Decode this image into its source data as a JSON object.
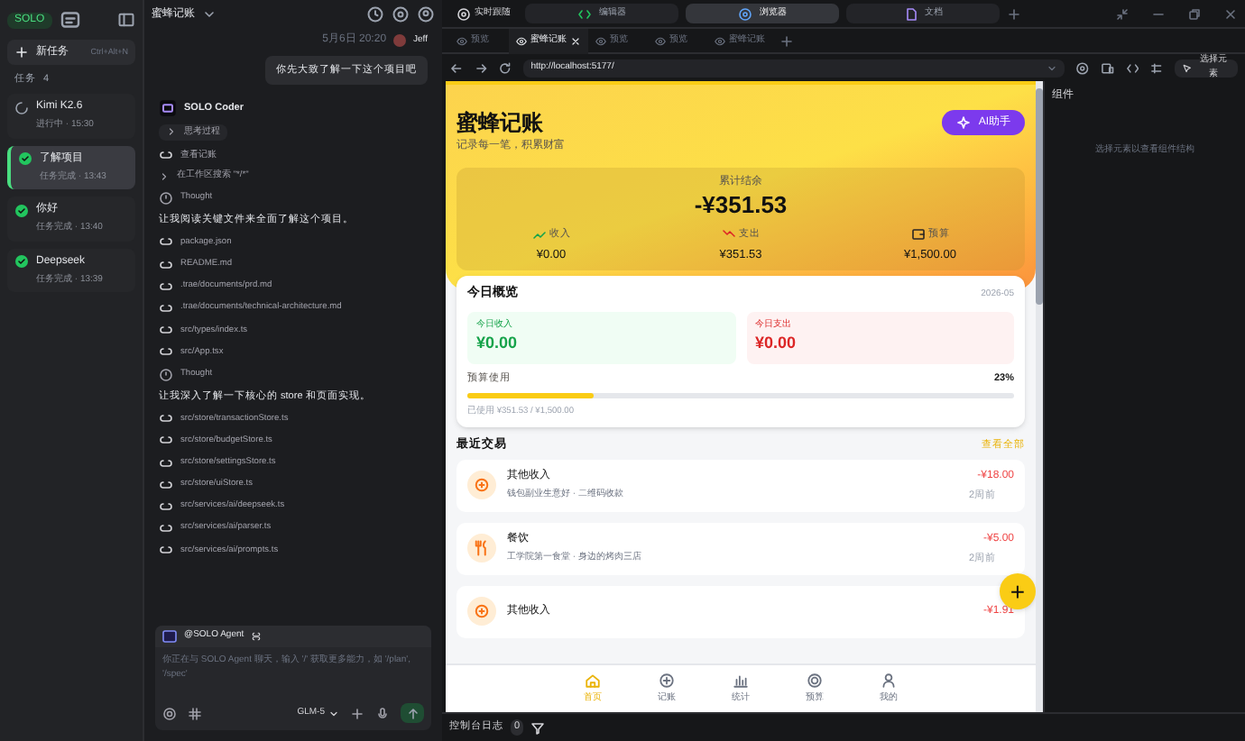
{
  "sidebar": {
    "logo": "SOLO",
    "new_task": {
      "label": "新任务",
      "shortcut": "Ctrl+Alt+N"
    },
    "tasks_label": "任务",
    "tasks_count": "4",
    "tasks": [
      {
        "title": "Kimi K2.6",
        "status": "进行中 · 15:30",
        "kind": "running",
        "selected": false
      },
      {
        "title": "了解项目",
        "status": "任务完成 · 13:43",
        "kind": "done",
        "selected": true
      },
      {
        "title": "你好",
        "status": "任务完成 · 13:40",
        "kind": "done",
        "selected": false
      },
      {
        "title": "Deepseek",
        "status": "任务完成 · 13:39",
        "kind": "done",
        "selected": false
      }
    ]
  },
  "chat": {
    "project": "蜜蜂记账",
    "time": "5月6日 20:20",
    "user": "Jeff",
    "message": "你先大致了解一下这个项目吧",
    "agent": "SOLO Coder",
    "steps": [
      {
        "kind": "toggle",
        "text": "思考过程"
      },
      {
        "kind": "file",
        "text": "查看记账"
      },
      {
        "kind": "arrow",
        "text": "在工作区搜索 \"*/*\""
      },
      {
        "kind": "thought",
        "text": "Thought"
      },
      {
        "kind": "text",
        "text": "让我阅读关键文件来全面了解这个项目。"
      },
      {
        "kind": "file",
        "text": "package.json"
      },
      {
        "kind": "file",
        "text": "README.md"
      },
      {
        "kind": "file",
        "text": ".trae/documents/prd.md"
      },
      {
        "kind": "file",
        "text": ".trae/documents/technical-architecture.md"
      },
      {
        "kind": "file",
        "text": "src/types/index.ts"
      },
      {
        "kind": "file",
        "text": "src/App.tsx"
      },
      {
        "kind": "thought",
        "text": "Thought"
      },
      {
        "kind": "text",
        "text": "让我深入了解一下核心的 store 和页面实现。"
      },
      {
        "kind": "file",
        "text": "src/store/transactionStore.ts"
      },
      {
        "kind": "file",
        "text": "src/store/budgetStore.ts"
      },
      {
        "kind": "file",
        "text": "src/store/settingsStore.ts"
      },
      {
        "kind": "file",
        "text": "src/store/uiStore.ts"
      },
      {
        "kind": "file",
        "text": "src/services/ai/deepseek.ts"
      },
      {
        "kind": "file",
        "text": "src/services/ai/parser.ts"
      },
      {
        "kind": "file",
        "text": "src/services/ai/prompts.ts"
      }
    ],
    "input": {
      "agent": "@SOLO Agent",
      "placeholder": "你正在与 SOLO Agent 聊天，输入 '/' 获取更多能力，如 '/plan', '/spec'",
      "model": "GLM-5"
    }
  },
  "top_bar": {
    "follow": "实时跟随",
    "views": [
      {
        "label": "编辑器",
        "selected": false
      },
      {
        "label": "浏览器",
        "selected": true
      },
      {
        "label": "文档",
        "selected": false
      }
    ]
  },
  "browser_tabs": [
    {
      "label": "预览",
      "selected": false
    },
    {
      "label": "蜜蜂记账",
      "selected": true
    },
    {
      "label": "预览",
      "selected": false
    },
    {
      "label": "预览",
      "selected": false
    },
    {
      "label": "蜜蜂记账",
      "selected": false
    }
  ],
  "url": "http://localhost:5177/",
  "select_element": "选择元素",
  "app": {
    "title": "蜜蜂记账",
    "subtitle": "记录每一笔，积累财富",
    "ai_button": "AI助手",
    "balance_label": "累计结余",
    "balance": "-¥351.53",
    "stats": [
      {
        "kind": "income",
        "label": "收入",
        "value": "¥0.00"
      },
      {
        "kind": "expense",
        "label": "支出",
        "value": "¥351.53"
      },
      {
        "kind": "budget",
        "label": "预算",
        "value": "¥1,500.00"
      }
    ],
    "today": {
      "title": "今日概览",
      "date": "2026-05",
      "income_label": "今日收入",
      "income": "¥0.00",
      "expense_label": "今日支出",
      "expense": "¥0.00",
      "budget_label": "预算使用",
      "budget_percent": "23%",
      "level": 0.23,
      "budget_detail": "已使用 ¥351.53 / ¥1,500.00"
    },
    "recent_title": "最近交易",
    "view_all": "查看全部",
    "transactions": [
      {
        "kind": "income",
        "title": "其他收入",
        "detail": "钱包副业生意好 · 二维码收款",
        "amount": "-¥18.00",
        "time": "2周前"
      },
      {
        "kind": "food",
        "title": "餐饮",
        "detail": "工学院第一食堂 · 身边的烤肉三店",
        "amount": "-¥5.00",
        "time": "2周前"
      },
      {
        "kind": "income",
        "title": "其他收入",
        "amount": "-¥1.91"
      }
    ],
    "fab": "+",
    "nav": [
      {
        "kind": "home",
        "label": "首页",
        "selected": true
      },
      {
        "kind": "add",
        "label": "记账",
        "selected": false
      },
      {
        "kind": "stats",
        "label": "统计",
        "selected": false
      },
      {
        "kind": "budget",
        "label": "预算",
        "selected": false
      },
      {
        "kind": "user",
        "label": "我的",
        "selected": false
      }
    ]
  },
  "right_panel": {
    "title": "组件",
    "hint": "选择元素以查看组件结构"
  },
  "console": {
    "label": "控制台日志",
    "count": "0"
  }
}
